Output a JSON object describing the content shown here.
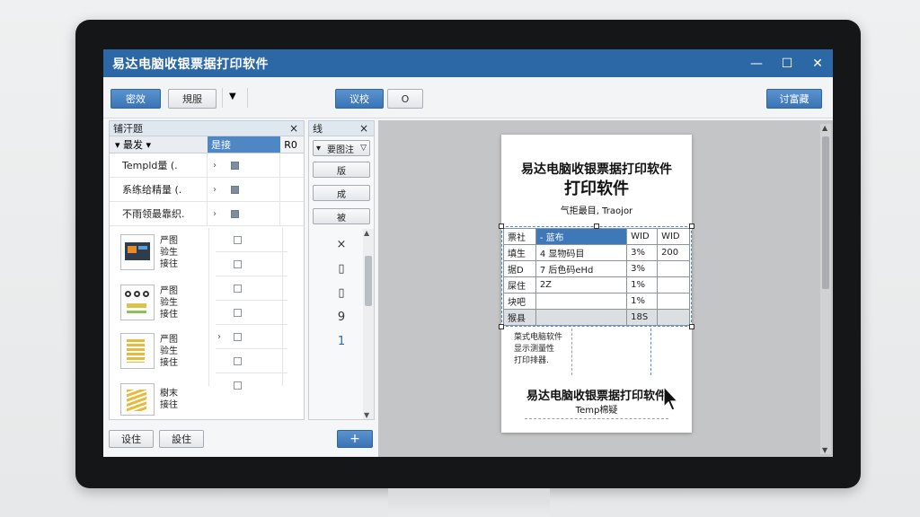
{
  "window": {
    "title": "易达电脑收银票据打印软件",
    "controls": [
      "—",
      "☐",
      "✕"
    ]
  },
  "toolbar": {
    "btn1": "密效",
    "btn2": "規服",
    "btn3": "议校",
    "btn4": "O",
    "btn_right": "讨富藏"
  },
  "left_panel": {
    "title": "铺汗题",
    "close": "×",
    "header_col1": "最发",
    "header_col2": "是接",
    "header_col3": "R0",
    "rows": [
      {
        "label": "Templd量 (."
      },
      {
        "label": "系练给精量 (."
      },
      {
        "label": "不雨领最靠织."
      }
    ],
    "templates": [
      {
        "lines": [
          "严图",
          "验生",
          "接往"
        ]
      },
      {
        "lines": [
          "严图",
          "验生",
          "接住"
        ]
      },
      {
        "lines": [
          "严图",
          "验生",
          "接住"
        ]
      },
      {
        "lines": [
          "樹末",
          "接往"
        ]
      }
    ],
    "btn_left": "设住",
    "btn_mid": "設住"
  },
  "mid_panel": {
    "title": "线",
    "close": "×",
    "dropdown": "要图注",
    "btn1": "版",
    "btn2": "成",
    "btn3": "被",
    "glyphs": [
      "×",
      "▯",
      "▯",
      "9",
      "1"
    ],
    "add_btn": "+"
  },
  "document": {
    "title1": "易达电脑收银票据打印软件",
    "title2": "打印软件",
    "subtitle": "气拒最目, Traojor",
    "table": [
      [
        "票社",
        "- 蓝布",
        "WID",
        "WID"
      ],
      [
        "填生",
        "4 显物码目",
        "3%",
        "200"
      ],
      [
        "据D",
        "7 后色码eHd",
        "3%",
        ""
      ],
      [
        "屎住",
        "2Z",
        "1%",
        ""
      ],
      [
        "块吧",
        "",
        "1%",
        ""
      ],
      [
        "猴县",
        "",
        "18S",
        ""
      ]
    ],
    "footer_lines": [
      "菜式电脑软件",
      "显示测量性",
      "打印排器."
    ],
    "footer_title": "易达电脑收银票据打印软件",
    "footer_sub": "Temp棉疑"
  }
}
